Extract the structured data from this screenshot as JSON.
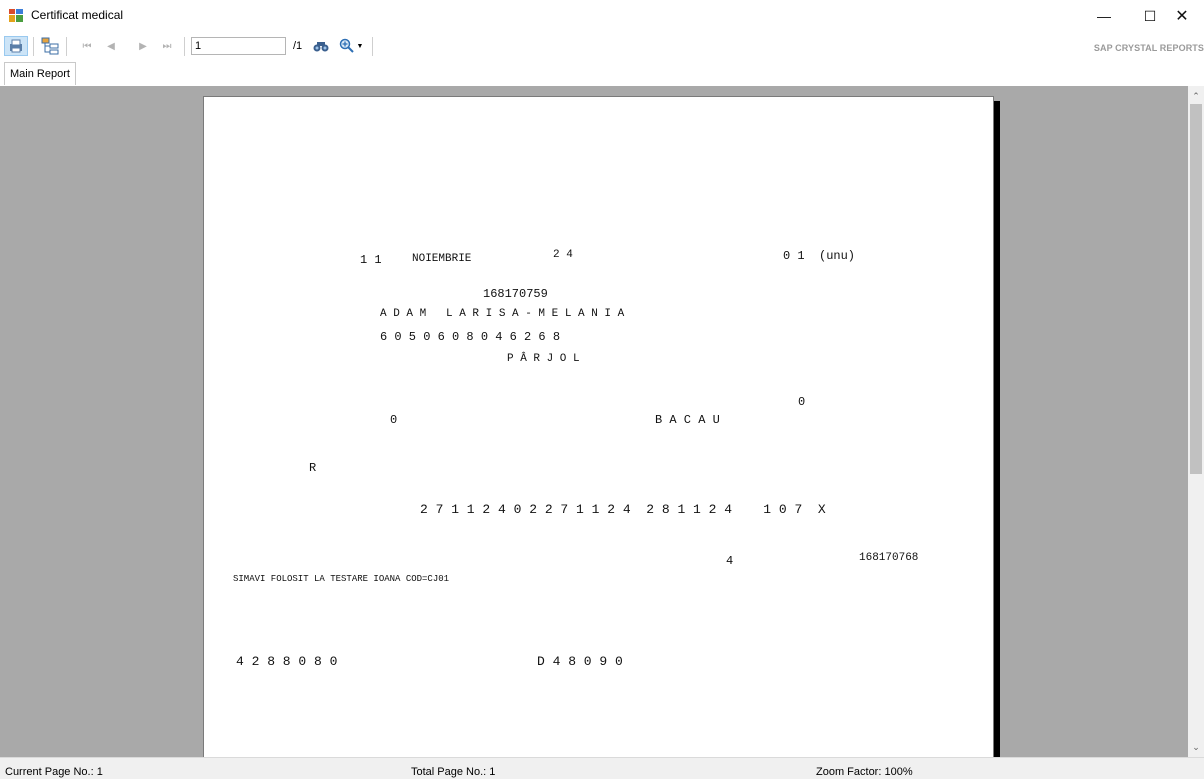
{
  "window": {
    "title": "Certificat medical",
    "minimize_glyph": "—",
    "maximize_glyph": "☐",
    "close_glyph": "✕"
  },
  "toolbar": {
    "page_input_value": "1",
    "page_total": "/1",
    "brand": "SAP CRYSTAL REPORTS",
    "icons": [
      "export-icon",
      "toggle-group-tree-icon",
      "first-page-icon",
      "previous-page-icon",
      "next-page-icon",
      "last-page-icon",
      "find-icon",
      "zoom-icon"
    ]
  },
  "tabs": [
    {
      "label": "Main Report"
    }
  ],
  "document": {
    "day": "1 1",
    "month": "NOIEMBRIE",
    "year": "2 4",
    "count": "0 1  (unu)",
    "series_no": "168170759",
    "full_name": "A D A M   L A R I S A - M E L A N I A",
    "cnp": "6 0 5 0 6 0 8 0 4 6 2 6 8",
    "locality": "P Â R J O L",
    "value_right": "0",
    "value_left": "0",
    "county": "B A C A U",
    "letter_r": "R",
    "codes": "2 7 1 1 2 4 0 2 2 7 1 1 2 4  2 8 1 1 2 4    1 0 7  X",
    "number_4": "4",
    "series_no_2": "168170768",
    "note": "SIMAVI FOLOSIT LA TESTARE IOANA COD=CJ01",
    "bottom_left": "4 2 8 8 0 8 0",
    "bottom_mid": "D 4 8 0 9 0"
  },
  "statusbar": {
    "current_page": "Current Page No.: 1",
    "total_page": "Total Page No.: 1",
    "zoom": "Zoom Factor: 100%"
  }
}
